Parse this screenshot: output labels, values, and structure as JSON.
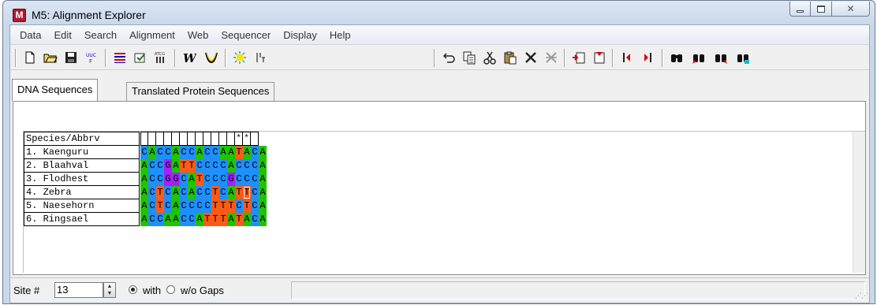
{
  "window": {
    "title": "M5: Alignment Explorer",
    "app_icon_letter": "M"
  },
  "menu": [
    "Data",
    "Edit",
    "Search",
    "Alignment",
    "Web",
    "Sequencer",
    "Display",
    "Help"
  ],
  "toolbar": {
    "icons": [
      "new-icon",
      "open-icon",
      "save-icon",
      "translate-icon",
      "align-icon",
      "build-icon",
      "muscle-icon",
      "clustal-icon",
      "trace-icon",
      "mark-site-icon",
      "undo-icon",
      "copy-icon",
      "cut-icon",
      "paste-icon",
      "delete-icon",
      "delete-gap-icon",
      "insert-icon",
      "insert-gap-icon",
      "move-left-icon",
      "move-right-icon",
      "find-icon",
      "find-previous-icon",
      "find-next-icon",
      "find-marked-icon"
    ]
  },
  "tabs": [
    {
      "label": "DNA Sequences",
      "active": true
    },
    {
      "label": "Translated Protein Sequences",
      "active": false
    }
  ],
  "alignment": {
    "header": "Species/Abbrv",
    "consensus": [
      "",
      "",
      "",
      "",
      "",
      "",
      "",
      "",
      "",
      "",
      "",
      "",
      "*",
      "*",
      ""
    ],
    "sequences": [
      {
        "name": "1. Kaenguru",
        "bases": "CACCACCACCAATACA"
      },
      {
        "name": "2. Blaahval",
        "bases": "ACCGATTCCCCACCCA"
      },
      {
        "name": "3. Flodhest",
        "bases": "ACCGGCATCCCGCCCA"
      },
      {
        "name": "4. Zebra",
        "bases": "ACTCACACCTCATTCA"
      },
      {
        "name": "5. Naesehorn",
        "bases": "ACTCACCCCTTTCTCA"
      },
      {
        "name": "6. Ringsael",
        "bases": "ACCAACCATTTATACA"
      }
    ],
    "selected_cell": {
      "row": 3,
      "col": 13
    },
    "colors": {
      "A": "#1fc400",
      "C": "#1f8ffb",
      "G": "#a222ff",
      "T": "#ff5a16"
    }
  },
  "status": {
    "site_label": "Site #",
    "site_value": "13",
    "with_gaps_label": "with",
    "without_gaps_label": "w/o Gaps",
    "with_gaps_selected": true
  }
}
